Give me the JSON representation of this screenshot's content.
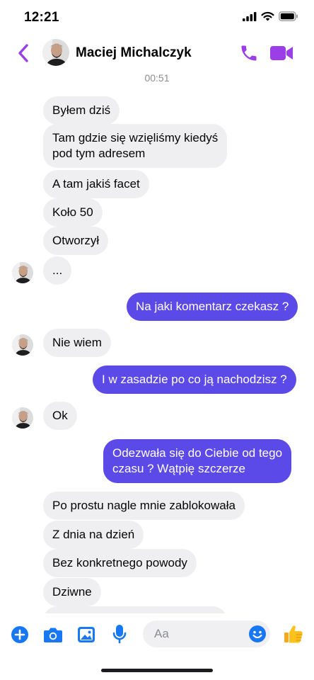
{
  "status_bar": {
    "time": "12:21"
  },
  "header": {
    "contact_name": "Maciej Michalczyk"
  },
  "timestamp": "00:51",
  "messages": [
    {
      "text": "Byłem dziś"
    },
    {
      "text_line1": "Tam gdzie się wzięliśmy kiedyś",
      "text_line2": "pod tym adresem"
    },
    {
      "text": "A tam jakiś facet"
    },
    {
      "text": "Koło 50"
    },
    {
      "text": "Otworzył"
    },
    {
      "text": "..."
    },
    {
      "text": "Na jaki komentarz czekasz ?"
    },
    {
      "text": "Nie wiem"
    },
    {
      "text": "I w zasadzie po co ją nachodzisz ?"
    },
    {
      "text": "Ok"
    },
    {
      "text_line1": "Odezwała się do Ciebie od tego",
      "text_line2": "czasu ? Wątpię szczerze"
    },
    {
      "text": "Po prostu nagle mnie zablokowała"
    },
    {
      "text": "Z dnia na dzień"
    },
    {
      "text": "Bez konkretnego powody"
    },
    {
      "text": "Dziwne"
    }
  ],
  "composer": {
    "placeholder": "Aa"
  },
  "colors": {
    "accent": "#9b3ee8",
    "outgoing": "#5b49e8",
    "incoming": "#efeff1",
    "composer_icons": "#1877f2"
  },
  "icons": [
    "back-chevron-icon",
    "phone-icon",
    "video-camera-icon",
    "plus-icon",
    "camera-icon",
    "image-icon",
    "microphone-icon",
    "emoji-icon",
    "thumbs-up-icon"
  ]
}
